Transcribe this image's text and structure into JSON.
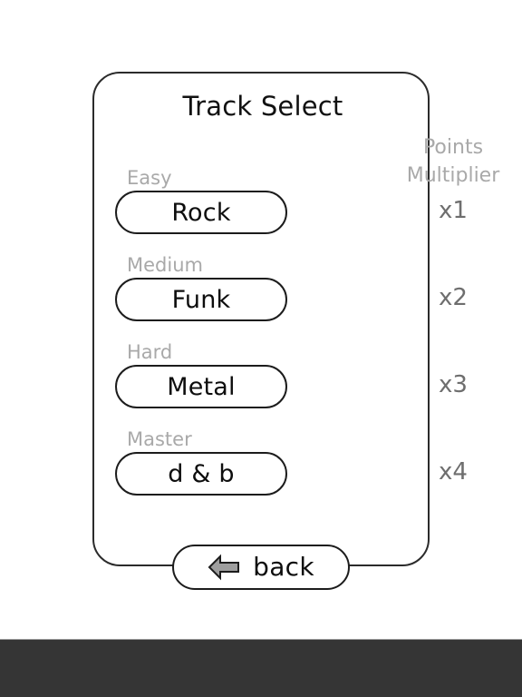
{
  "screen": {
    "background_color": "#ffffff",
    "panel_border_color": "#2b2b2b"
  },
  "panel": {
    "title": "Track Select",
    "points_multiplier_heading_line1": "Points",
    "points_multiplier_heading_line2": "Multiplier",
    "heading_color": "#a9a9a9"
  },
  "tracks": [
    {
      "difficulty": "Easy",
      "name": "Rock",
      "multiplier": "x1"
    },
    {
      "difficulty": "Medium",
      "name": "Funk",
      "multiplier": "x2"
    },
    {
      "difficulty": "Hard",
      "name": "Metal",
      "multiplier": "x3"
    },
    {
      "difficulty": "Master",
      "name": "d & b",
      "multiplier": "x4"
    }
  ],
  "back_button": {
    "label": "back",
    "icon": "left-arrow-icon",
    "icon_fill_color": "#9e9e9e",
    "icon_stroke_color": "#1c1c1c"
  },
  "system_nav_bar": {
    "background_color": "#353535"
  }
}
